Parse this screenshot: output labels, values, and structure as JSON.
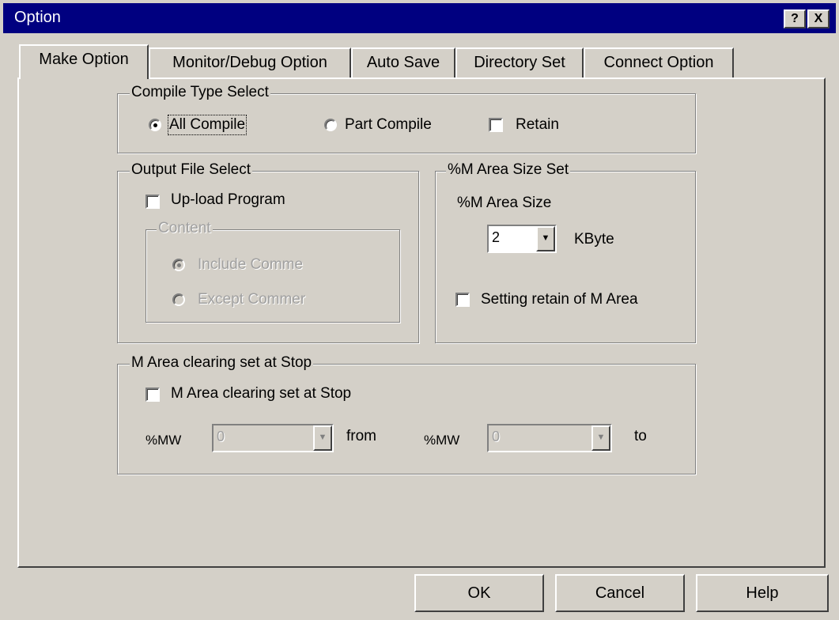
{
  "window": {
    "title": "Option",
    "help_glyph": "?",
    "close_glyph": "X"
  },
  "tabs": [
    "Make Option",
    "Monitor/Debug Option",
    "Auto Save",
    "Directory Set",
    "Connect Option"
  ],
  "active_tab": "Make Option",
  "compile_type": {
    "legend": "Compile Type Select",
    "all_compile": "All Compile",
    "part_compile": "Part Compile",
    "retain": "Retain",
    "selected": "All Compile",
    "retain_checked": false
  },
  "output_file": {
    "legend": "Output File Select",
    "upload_program": "Up-load Program",
    "upload_checked": false,
    "content_legend": "Content",
    "include_comment": "Include Comme",
    "except_comment": "Except Commer",
    "content_selected": "Include Comme",
    "content_enabled": false
  },
  "m_area_size": {
    "legend": "%M Area Size Set",
    "label": "%M Area Size",
    "value": "2",
    "unit": "KByte",
    "setting_retain": "Setting retain of M Area",
    "setting_retain_checked": false
  },
  "m_area_clearing": {
    "legend": "M Area clearing set at Stop",
    "checkbox_label": "M Area clearing set at Stop",
    "checked": false,
    "from_prefix": "%MW",
    "from_value": "0",
    "from_label": "from",
    "to_prefix": "%MW",
    "to_value": "0",
    "to_label": "to",
    "enabled": false
  },
  "buttons": {
    "ok": "OK",
    "cancel": "Cancel",
    "help": "Help"
  },
  "icons": {
    "dropdown": "dropdown-arrow-icon",
    "help": "help-icon",
    "close": "close-icon"
  }
}
